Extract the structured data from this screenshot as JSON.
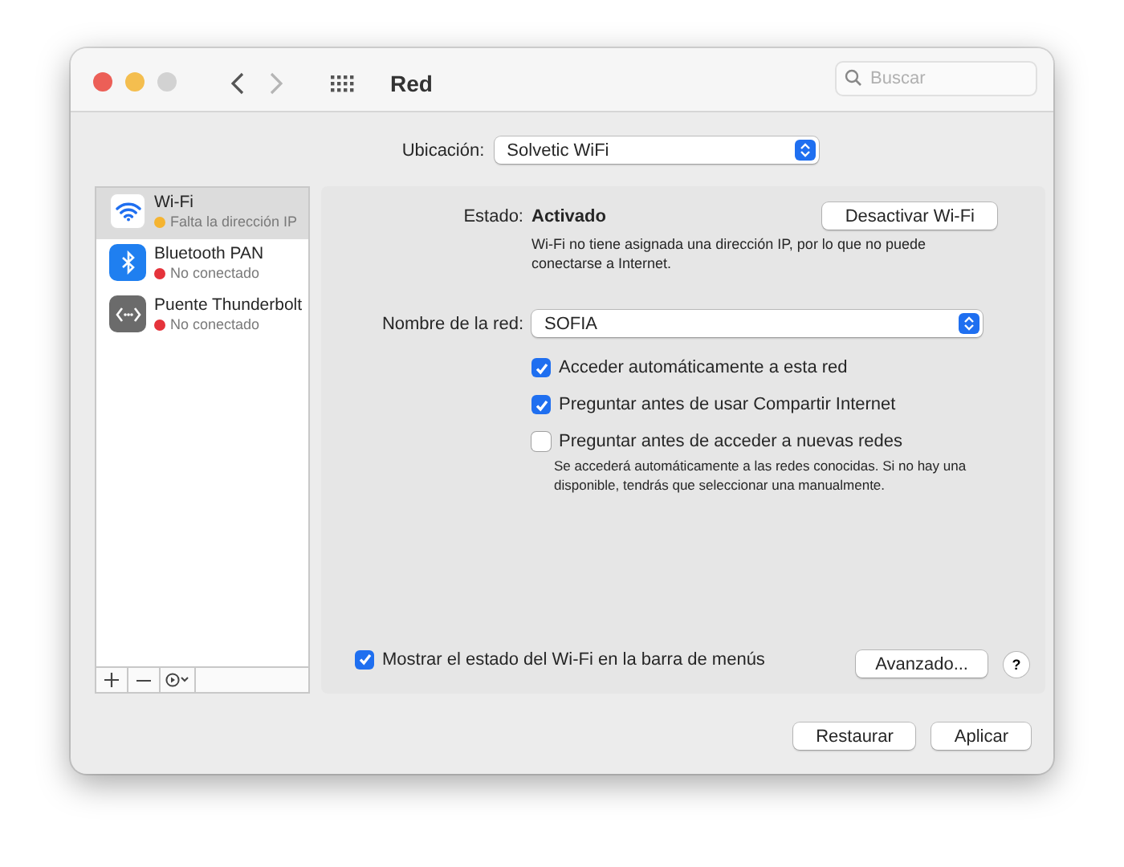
{
  "window": {
    "title": "Red",
    "search": {
      "placeholder": "Buscar"
    }
  },
  "location": {
    "label": "Ubicación:",
    "value": "Solvetic WiFi"
  },
  "services": [
    {
      "kind": "wifi",
      "name": "Wi-Fi",
      "status": "Falta la dirección IP",
      "color": "#f5b431",
      "selected": true
    },
    {
      "kind": "bluetooth",
      "name": "Bluetooth PAN",
      "status": "No conectado",
      "color": "#e5333b",
      "selected": false
    },
    {
      "kind": "thunderbolt",
      "name": "Puente Thunderbolt",
      "status": "No conectado",
      "color": "#e5333b",
      "selected": false
    }
  ],
  "detail": {
    "status_label": "Estado:",
    "status_value": "Activado",
    "toggle_button": "Desactivar Wi-Fi",
    "status_note": "Wi-Fi no tiene asignada una dirección IP, por lo que no puede conectarse a Internet.",
    "network_label": "Nombre de la red:",
    "network_value": "SOFIA",
    "options": [
      {
        "label": "Acceder automáticamente a esta red",
        "checked": true
      },
      {
        "label": "Preguntar antes de usar Compartir Internet",
        "checked": true
      },
      {
        "label": "Preguntar antes de acceder a nuevas redes",
        "checked": false,
        "note": "Se accederá automáticamente a las redes conocidas. Si no hay una disponible, tendrás que seleccionar una manualmente."
      }
    ],
    "menubar_option": {
      "label": "Mostrar el estado del Wi-Fi en la barra de menús",
      "checked": true
    },
    "advanced_button": "Avanzado...",
    "help_button": "?"
  },
  "footer": {
    "buttons": [
      "Restaurar",
      "Aplicar"
    ]
  }
}
